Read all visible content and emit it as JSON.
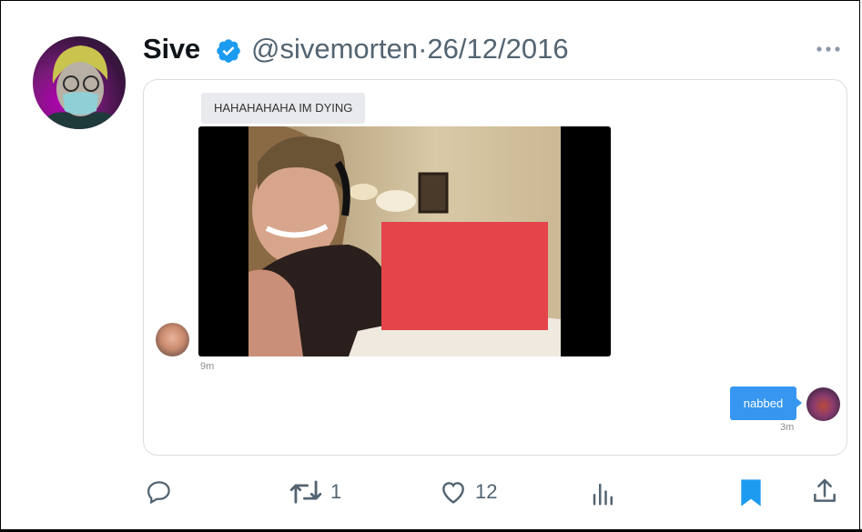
{
  "tweet": {
    "author_name": "Sive",
    "author_handle": "@sivemorten",
    "separator": "·",
    "date": "26/12/2016",
    "verified": true
  },
  "dm": {
    "incoming_message": "HAHAHAHAHA IM DYING",
    "incoming_time": "9m",
    "outgoing_message": "nabbed",
    "outgoing_time": "3m"
  },
  "actions": {
    "reply_count": "",
    "retweet_count": "1",
    "like_count": "12",
    "views_count": "",
    "bookmarked": true
  },
  "colors": {
    "verified_blue": "#1d9bf0",
    "bubble_blue": "#3797f0",
    "bubble_gray": "#e9eaee",
    "redaction_red": "#e5444b",
    "icon_gray": "#536471"
  },
  "icons": [
    "verified-badge-icon",
    "more-icon",
    "reply-icon",
    "retweet-icon",
    "like-icon",
    "views-icon",
    "bookmark-icon",
    "share-icon"
  ]
}
